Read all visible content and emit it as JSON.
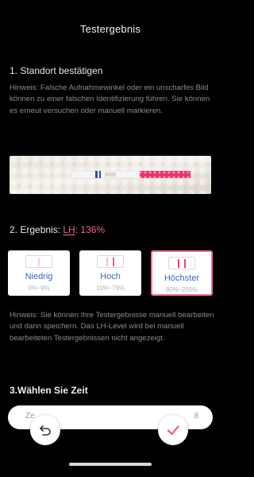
{
  "header": {
    "title": "Testergebnis"
  },
  "section1": {
    "title": "1. Standort bestätigen",
    "hint": "Hinweis: Falsche Aufnahmewinkel oder ein unscharfes Bild können zu einer falschen Identifizierung führen. Sie können es erneut versuchen oder manuell markieren."
  },
  "result": {
    "prefix": "2. Ergebnis: ",
    "lh_label": "LH",
    "colon": ": ",
    "percent": "136%"
  },
  "levels": [
    {
      "label": "Niedrig",
      "range": "0%~9%"
    },
    {
      "label": "Hoch",
      "range": "10%~79%"
    },
    {
      "label": "Höchster",
      "range": "80%~200%"
    }
  ],
  "selected_level": "Höchster",
  "hint2": "Hinweis: Sie können Ihre Testergebnisse manuell bearbeiten und dann speichern. Das LH-Level wird bei manuell bearbeiteten Testergebnissen nicht angezeigt.",
  "section3": {
    "title": "3.Wählen Sie Zeit",
    "time_left": "Ze",
    "time_right": "8"
  },
  "colors": {
    "accent": "#f06595",
    "label_blue": "#3b6bc1",
    "selected_border": "#ff6ea5"
  },
  "icons": {
    "close": "close-icon",
    "undo": "undo-icon",
    "confirm": "checkmark-icon"
  }
}
